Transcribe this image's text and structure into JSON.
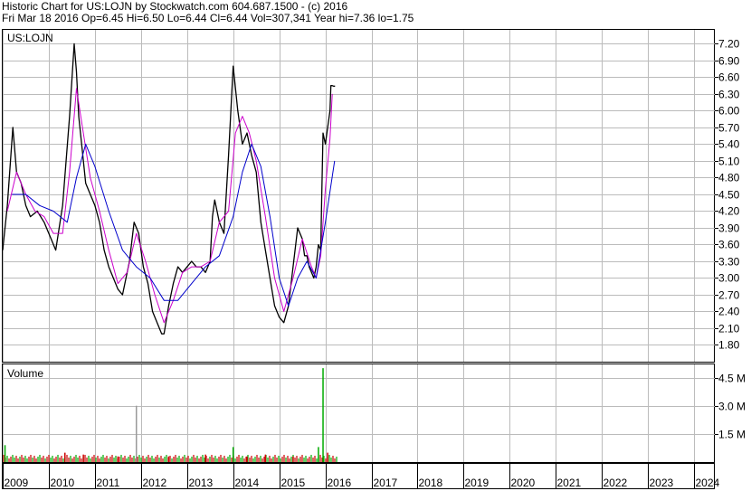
{
  "header": {
    "line1": "Historic Chart for US:LOJN by Stockwatch.com 604.687.1500 - (c) 2016",
    "line2": "Fri Mar 18 2016  Op=6.45  Hi=6.50  Lo=6.44  Cl=6.44  Vol=307,341  Year hi=7.36  lo=1.75"
  },
  "colors": {
    "price": "#000000",
    "ma_short": "#cc00cc",
    "ma_long": "#0000cc",
    "vol_up": "#00aa00",
    "vol_down": "#cc0000",
    "vol_flat": "#999999",
    "grid": "#bbbbbb"
  },
  "chart_data": [
    {
      "type": "line",
      "title": "US:LOJN",
      "x_range": [
        2009.0,
        2024.45
      ],
      "ylim": [
        1.5,
        7.45
      ],
      "y_ticks": [
        "1.80",
        "2.10",
        "2.40",
        "2.70",
        "3.00",
        "3.30",
        "3.60",
        "3.90",
        "4.20",
        "4.50",
        "4.80",
        "5.10",
        "5.40",
        "5.70",
        "6.00",
        "6.30",
        "6.60",
        "6.90",
        "7.20"
      ],
      "x_ticks": [
        "2009",
        "2010",
        "2011",
        "2012",
        "2013",
        "2014",
        "2015",
        "2016",
        "2017",
        "2018",
        "2019",
        "2020",
        "2021",
        "2022",
        "2023",
        "2024"
      ],
      "series": [
        {
          "x": [
            2009.0,
            2009.1,
            2009.22,
            2009.3,
            2009.4,
            2009.5,
            2009.6,
            2009.75,
            2009.9,
            2010.05,
            2010.15,
            2010.3,
            2010.45,
            2010.55,
            2010.6,
            2010.65,
            2010.7,
            2010.8,
            2010.9,
            2011.0,
            2011.1,
            2011.2,
            2011.3,
            2011.4,
            2011.5,
            2011.6,
            2011.75,
            2011.85,
            2011.95,
            2012.05,
            2012.15,
            2012.25,
            2012.35,
            2012.45,
            2012.5,
            2012.6,
            2012.7,
            2012.8,
            2012.9,
            2013.0,
            2013.1,
            2013.2,
            2013.3,
            2013.4,
            2013.5,
            2013.55,
            2013.6,
            2013.65,
            2013.7,
            2013.8,
            2013.9,
            2014.0,
            2014.1,
            2014.2,
            2014.3,
            2014.4,
            2014.5,
            2014.6,
            2014.7,
            2014.8,
            2014.9,
            2015.0,
            2015.1,
            2015.2,
            2015.3,
            2015.4,
            2015.5,
            2015.55,
            2015.6,
            2015.65,
            2015.7,
            2015.75,
            2015.8,
            2015.85,
            2015.9,
            2015.92,
            2015.95,
            2016.0,
            2016.1,
            2016.12,
            2016.15,
            2016.18,
            2016.21
          ],
          "values": [
            3.5,
            4.3,
            5.7,
            4.9,
            4.7,
            4.3,
            4.1,
            4.2,
            4.0,
            3.7,
            3.5,
            4.3,
            5.9,
            7.2,
            6.7,
            5.9,
            5.5,
            4.7,
            4.5,
            4.3,
            4.0,
            3.5,
            3.2,
            3.0,
            2.8,
            2.7,
            3.3,
            4.0,
            3.8,
            3.2,
            2.9,
            2.4,
            2.2,
            2.0,
            2.0,
            2.5,
            2.9,
            3.2,
            3.1,
            3.2,
            3.3,
            3.2,
            3.2,
            3.1,
            3.3,
            4.1,
            4.4,
            4.2,
            4.0,
            3.8,
            5.2,
            6.8,
            6.0,
            5.4,
            5.6,
            5.2,
            4.9,
            4.0,
            3.5,
            3.0,
            2.5,
            2.3,
            2.2,
            2.5,
            3.2,
            3.9,
            3.7,
            3.4,
            3.4,
            3.2,
            3.1,
            3.0,
            3.2,
            3.6,
            3.5,
            4.4,
            5.6,
            5.4,
            6.0,
            6.45,
            6.45,
            6.44,
            6.44
          ]
        },
        {
          "x": [
            2009.1,
            2009.3,
            2009.5,
            2009.7,
            2009.9,
            2010.1,
            2010.3,
            2010.45,
            2010.6,
            2010.75,
            2010.9,
            2011.1,
            2011.3,
            2011.5,
            2011.7,
            2011.9,
            2012.1,
            2012.3,
            2012.5,
            2012.7,
            2012.9,
            2013.1,
            2013.3,
            2013.5,
            2013.7,
            2013.9,
            2014.05,
            2014.2,
            2014.35,
            2014.5,
            2014.7,
            2014.9,
            2015.1,
            2015.3,
            2015.5,
            2015.7,
            2015.8,
            2015.9,
            2016.0,
            2016.1,
            2016.15
          ],
          "values": [
            4.2,
            4.9,
            4.5,
            4.2,
            4.1,
            3.8,
            3.8,
            4.9,
            6.4,
            5.6,
            4.8,
            4.2,
            3.5,
            2.9,
            3.1,
            3.8,
            3.3,
            2.7,
            2.2,
            2.6,
            3.1,
            3.2,
            3.2,
            3.3,
            4.0,
            4.2,
            5.6,
            5.9,
            5.6,
            5.1,
            4.1,
            3.0,
            2.4,
            3.0,
            3.7,
            3.2,
            3.0,
            3.4,
            4.6,
            5.5,
            6.3
          ]
        },
        {
          "x": [
            2009.2,
            2009.5,
            2009.8,
            2010.1,
            2010.4,
            2010.6,
            2010.8,
            2011.0,
            2011.3,
            2011.6,
            2011.9,
            2012.2,
            2012.5,
            2012.8,
            2013.1,
            2013.4,
            2013.7,
            2014.0,
            2014.2,
            2014.4,
            2014.6,
            2014.8,
            2015.0,
            2015.2,
            2015.4,
            2015.6,
            2015.8,
            2016.0,
            2016.2
          ],
          "values": [
            4.5,
            4.5,
            4.3,
            4.2,
            4.0,
            4.8,
            5.4,
            5.0,
            4.2,
            3.5,
            3.2,
            3.0,
            2.6,
            2.6,
            2.9,
            3.2,
            3.4,
            4.1,
            4.9,
            5.4,
            5.0,
            4.1,
            3.0,
            2.5,
            3.0,
            3.3,
            3.0,
            4.0,
            5.1
          ]
        }
      ]
    },
    {
      "type": "bar",
      "title": "Volume",
      "ylim": [
        0,
        5.2
      ],
      "y_ticks": [
        "1.5 M",
        "3.0 M",
        "4.5 M"
      ],
      "spikes": [
        {
          "x": 2009.05,
          "value": 0.9
        },
        {
          "x": 2010.35,
          "value": 0.5
        },
        {
          "x": 2010.75,
          "value": 0.4
        },
        {
          "x": 2011.5,
          "value": 0.3
        },
        {
          "x": 2011.9,
          "value": 3.0
        },
        {
          "x": 2012.6,
          "value": 0.3
        },
        {
          "x": 2013.4,
          "value": 0.4
        },
        {
          "x": 2014.0,
          "value": 0.8
        },
        {
          "x": 2014.3,
          "value": 0.3
        },
        {
          "x": 2014.7,
          "value": 0.4
        },
        {
          "x": 2015.3,
          "value": 0.3
        },
        {
          "x": 2015.85,
          "value": 0.8
        },
        {
          "x": 2015.95,
          "value": 5.0
        },
        {
          "x": 2016.05,
          "value": 0.5
        }
      ]
    }
  ]
}
